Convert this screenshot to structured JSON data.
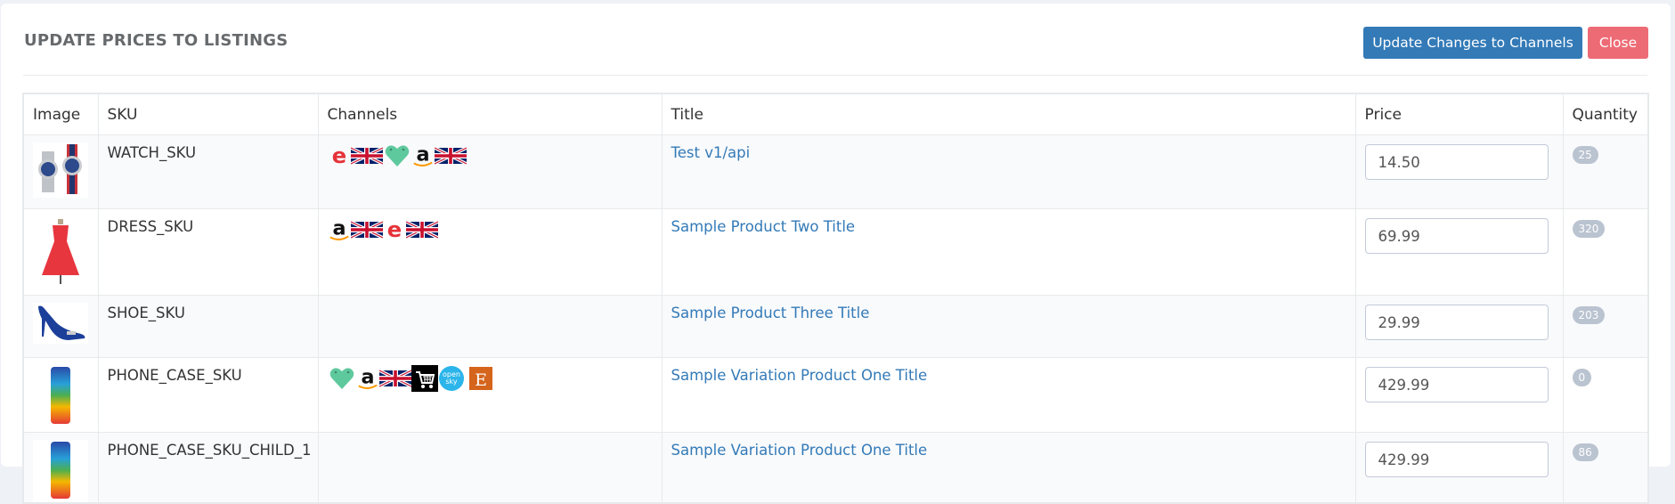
{
  "page": {
    "title": "UPDATE PRICES TO LISTINGS",
    "update_button_label": "Update Changes to Channels",
    "close_button_label": "Close"
  },
  "colors": {
    "primary": "#337ab7",
    "danger": "#ed6b75",
    "link": "#337ab7",
    "badge": "#bac3d0"
  },
  "table": {
    "headers": [
      "Image",
      "SKU",
      "Channels",
      "Title",
      "Price",
      "Quantity"
    ],
    "rows": [
      {
        "image": "watch-image",
        "sku": "WATCH_SKU",
        "channels": [
          "ebay-icon",
          "uk-flag-icon",
          "heart-tag-icon",
          "amazon-icon",
          "uk-flag-icon"
        ],
        "title": "Test v1/api",
        "price": "14.50",
        "quantity": "25"
      },
      {
        "image": "dress-image",
        "sku": "DRESS_SKU",
        "channels": [
          "amazon-icon",
          "uk-flag-icon",
          "ebay-icon",
          "uk-flag-icon"
        ],
        "title": "Sample Product Two Title",
        "price": "69.99",
        "quantity": "320"
      },
      {
        "image": "shoe-image",
        "sku": "SHOE_SKU",
        "channels": [],
        "title": "Sample Product Three Title",
        "price": "29.99",
        "quantity": "203"
      },
      {
        "image": "phone-case-image",
        "sku": "PHONE_CASE_SKU",
        "channels": [
          "heart-tag-icon",
          "amazon-icon",
          "uk-flag-icon",
          "cart-icon",
          "opensky-icon",
          "etsy-icon"
        ],
        "title": "Sample Variation Product One Title",
        "price": "429.99",
        "quantity": "0"
      },
      {
        "image": "phone-case-image",
        "sku": "PHONE_CASE_SKU_CHILD_1",
        "channels": [],
        "title": "Sample Variation Product One Title",
        "price": "429.99",
        "quantity": "86"
      }
    ]
  }
}
